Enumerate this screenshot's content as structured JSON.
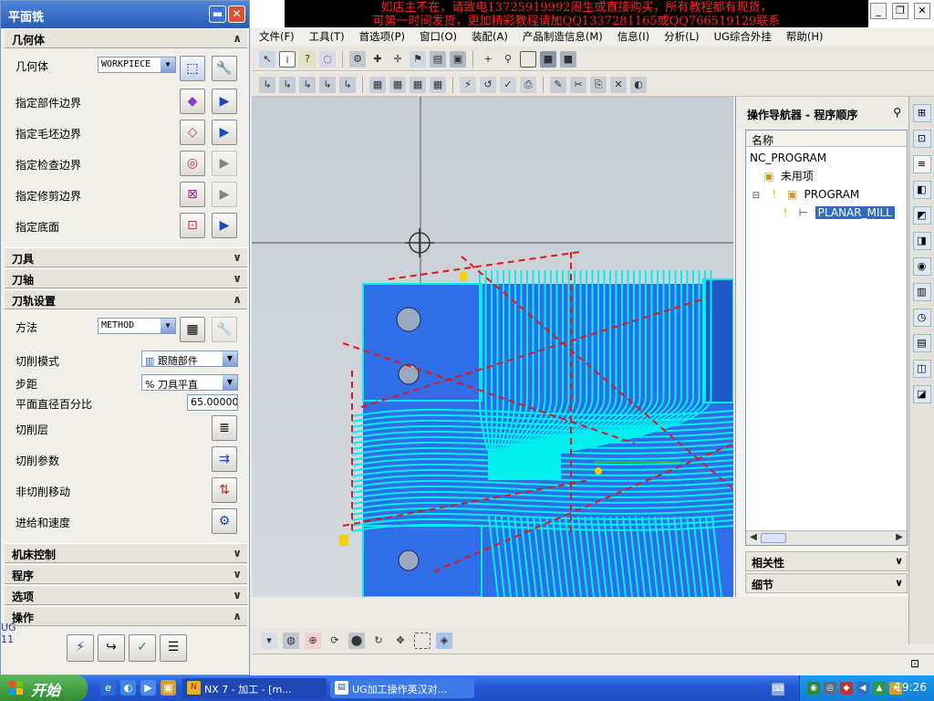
{
  "banner": {
    "line1": "如店主不在，请致电13725919992周生或直接购买，所有教程都有现货，",
    "line2": "可第一时间发货，更加精彩教程请加QQ1337281165或QQ766519129联系"
  },
  "menubar": [
    "文件(F)",
    "工具(T)",
    "首选项(P)",
    "窗口(O)",
    "装配(A)",
    "产品制造信息(M)",
    "信息(I)",
    "分析(L)",
    "UG综合外挂",
    "帮助(H)"
  ],
  "dialog": {
    "title": "平面铣",
    "sections": {
      "geometry": "几何体",
      "tool": "刀具",
      "axis": "刀轴",
      "path": "刀轨设置",
      "machine": "机床控制",
      "program": "程序",
      "options": "选项",
      "actions": "操作"
    },
    "geometry": {
      "label": "几何体",
      "value": "WORKPIECE",
      "rows": [
        "指定部件边界",
        "指定毛坯边界",
        "指定检查边界",
        "指定修剪边界",
        "指定底面"
      ]
    },
    "path": {
      "method_label": "方法",
      "method_value": "METHOD",
      "cut_mode_label": "切削模式",
      "cut_mode_value": "跟随部件",
      "stepover_label": "步距",
      "stepover_value": "% 刀具平直",
      "percent_label": "平面直径百分比",
      "percent_value": "65.00000",
      "cut_levels": "切削层",
      "cut_params": "切削参数",
      "non_cut": "非切削移动",
      "feeds": "进给和速度"
    },
    "side_tag": "UG\n11"
  },
  "navigator": {
    "title": "操作导航器 - 程序顺序",
    "column": "名称",
    "tree": [
      "NC_PROGRAM",
      "未用项",
      "PROGRAM",
      "PLANAR_MILL"
    ],
    "related": "相关性",
    "details": "细节"
  },
  "taskbar": {
    "start": "开始",
    "tasks": [
      "NX 7 - 加工 - [m...",
      "UG加工操作英汉对..."
    ],
    "clock": "19:26"
  },
  "colors": {
    "part": "#2f6ee6",
    "toolpath": "#00f0f0",
    "noncut": "#e01818",
    "title_blue": "#2a5cb8"
  }
}
